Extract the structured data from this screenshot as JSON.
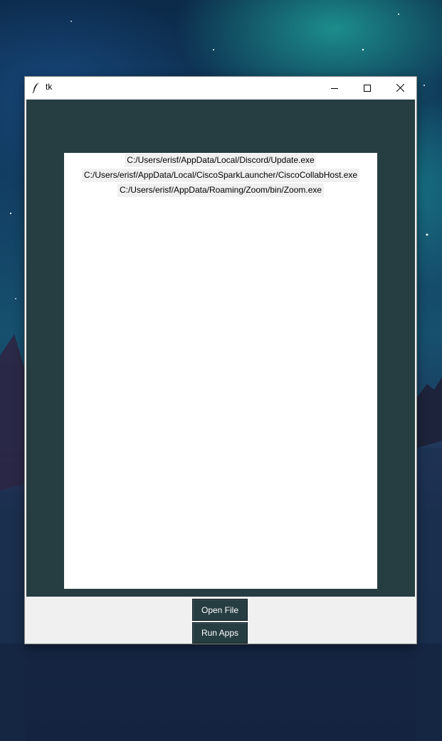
{
  "window": {
    "title": "tk",
    "controls": {
      "minimize": "minimize-icon",
      "maximize": "maximize-icon",
      "close": "close-icon"
    }
  },
  "listbox": {
    "items": [
      "C:/Users/erisf/AppData/Local/Discord/Update.exe",
      "C:/Users/erisf/AppData/Local/CiscoSparkLauncher/CiscoCollabHost.exe",
      "C:/Users/erisf/AppData/Roaming/Zoom/bin/Zoom.exe"
    ]
  },
  "buttons": {
    "open_file": "Open File",
    "run_apps": "Run Apps"
  },
  "colors": {
    "canvas_bg": "#263d42",
    "button_bg": "#263d42",
    "button_fg": "#ffffff",
    "list_bg": "#ffffff",
    "label_bg": "#f0f0f0"
  }
}
